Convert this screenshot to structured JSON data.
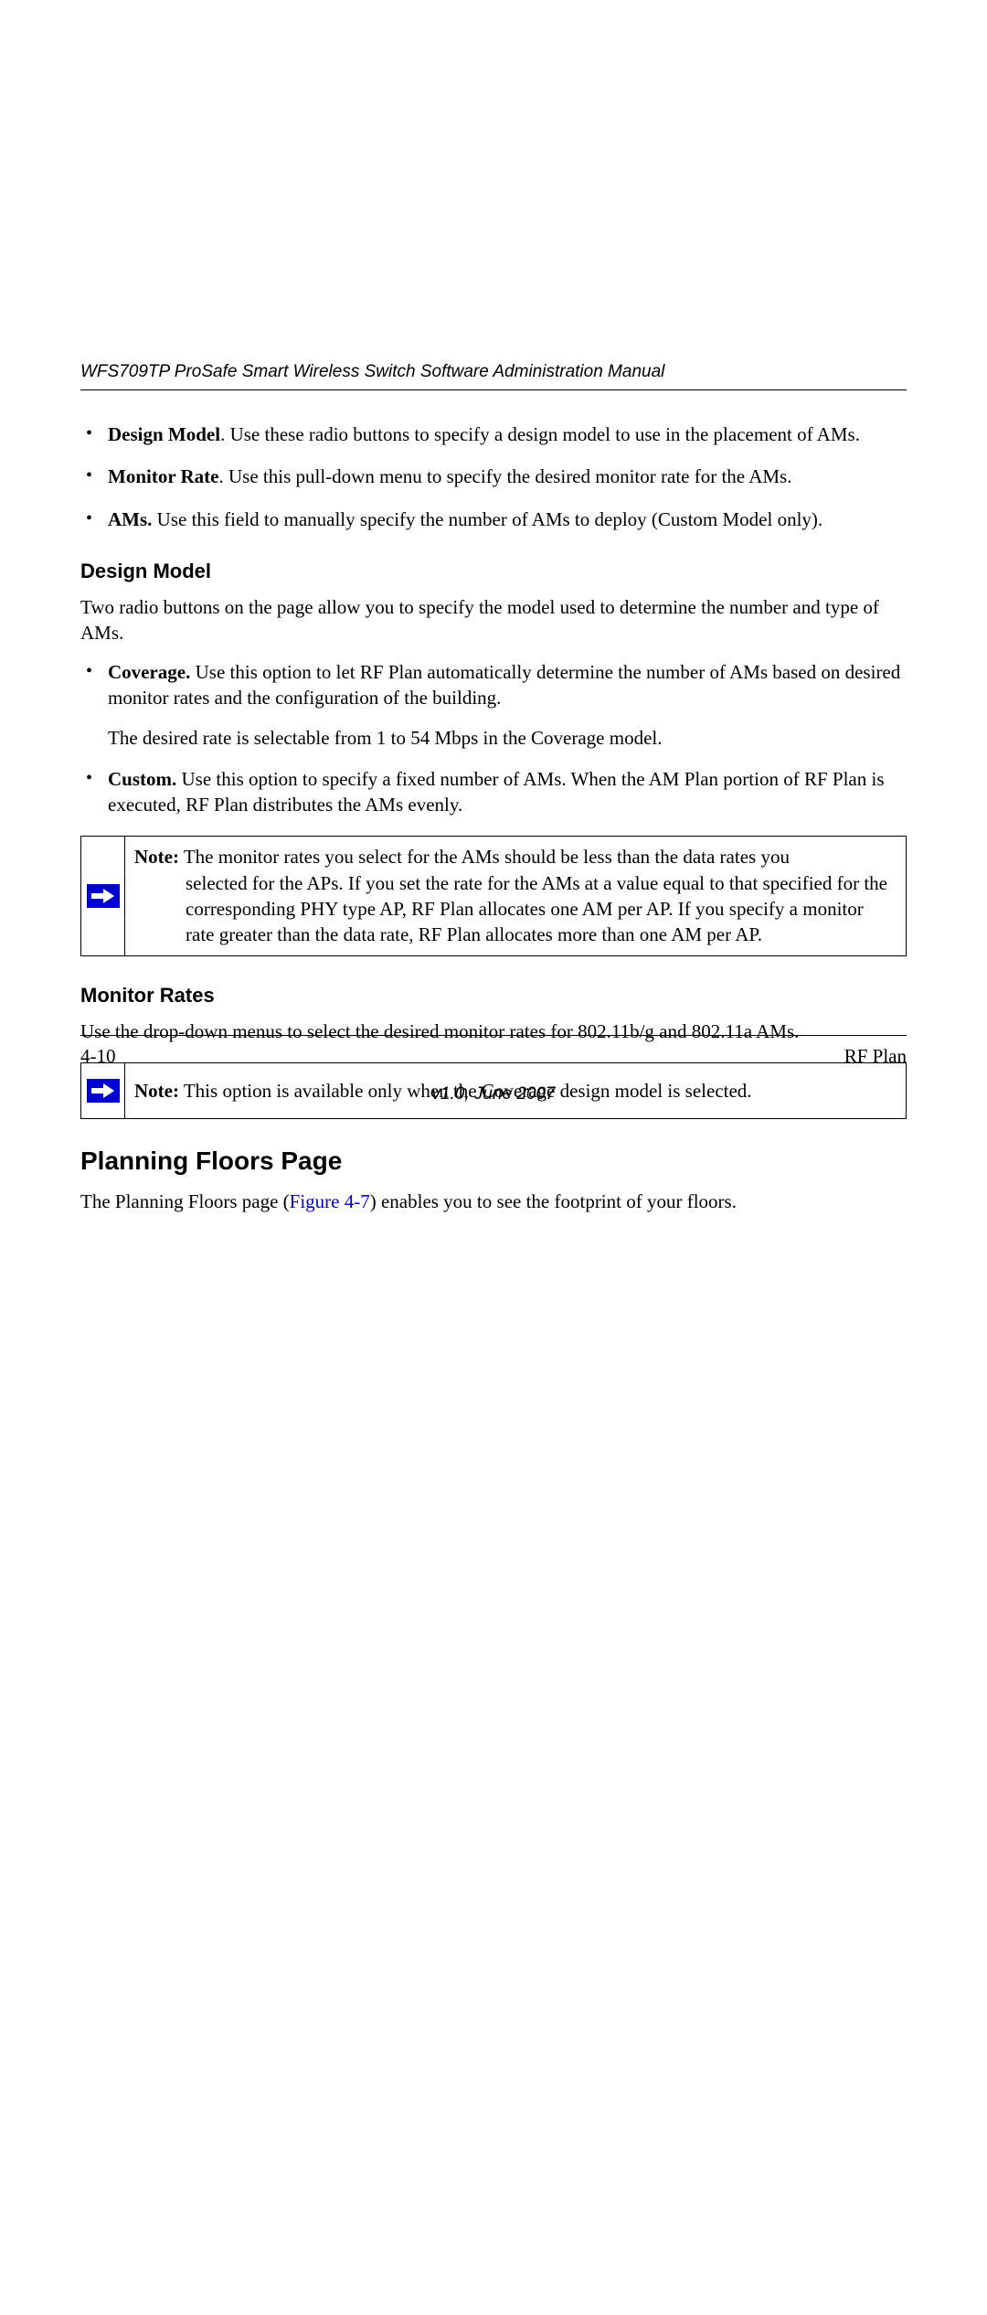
{
  "header": {
    "running_title": "WFS709TP ProSafe Smart Wireless Switch Software Administration Manual"
  },
  "bullets_top": [
    {
      "term": "Design Model",
      "sep": ". ",
      "text": "Use these radio buttons to specify a design model to use in the placement of AMs."
    },
    {
      "term": "Monitor Rate",
      "sep": ". ",
      "text": "Use this pull-down menu to specify the desired monitor rate for the AMs."
    },
    {
      "term": "AMs.",
      "sep": " ",
      "text": "Use this field to manually specify the number of AMs to deploy (Custom Model only)."
    }
  ],
  "section_design_model": {
    "heading": "Design Model",
    "intro": "Two radio buttons on the page allow you to specify the model used to determine the number and type of AMs.",
    "items": [
      {
        "term": "Coverage.",
        "text": " Use this option to let RF Plan automatically determine the number of AMs based on desired monitor rates and the configuration of the building.",
        "extra": "The desired rate is selectable from 1 to 54 Mbps in the Coverage model."
      },
      {
        "term": "Custom.",
        "text": " Use this option to specify a fixed number of AMs. When the AM Plan portion of RF Plan is executed, RF Plan distributes the AMs evenly."
      }
    ]
  },
  "note1": {
    "label": "Note:",
    "first_line": " The monitor rates you select for the AMs should be less than the data rates you",
    "rest": "selected for the APs. If you set the rate for the AMs at a value equal to that specified for the corresponding PHY type AP, RF Plan allocates one AM per AP. If you specify a monitor rate greater than the data rate, RF Plan allocates more than one AM per AP."
  },
  "section_monitor_rates": {
    "heading": "Monitor Rates",
    "intro": "Use the drop-down menus to select the desired monitor rates for 802.11b/g and 802.11a AMs."
  },
  "note2": {
    "label": "Note:",
    "text": " This option is available only when the Coverage design model is selected."
  },
  "section_planning": {
    "heading": "Planning Floors Page",
    "para_pre": "The Planning Floors page (",
    "link": "Figure 4-7",
    "para_post": ") enables you to see the footprint of your floors."
  },
  "footer": {
    "page": "4-10",
    "section": "RF Plan",
    "version": "v1.0, June 2007"
  }
}
